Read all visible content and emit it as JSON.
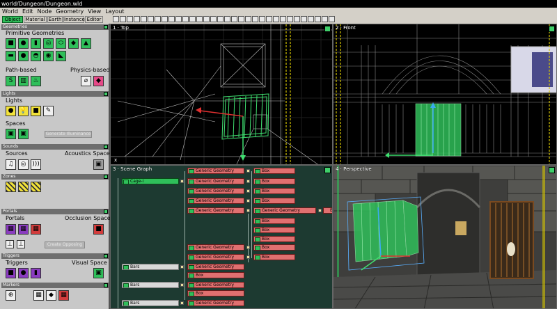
{
  "window": {
    "title": "world/Dungeon/Dungeon.wld"
  },
  "menu": [
    "World",
    "Edit",
    "Node",
    "Geometry",
    "View",
    "Layout"
  ],
  "tabs": [
    "Object",
    "Material",
    "Earth",
    "Instance",
    "Editor"
  ],
  "left": {
    "geometries": {
      "header": "Geometries",
      "primitive": "Primitive Geometries",
      "path": "Path-based",
      "physics": "Physics-based"
    },
    "lights": {
      "header": "Lights",
      "label": "Lights",
      "spaces": "Spaces",
      "generate": "Generate Illuminance"
    },
    "sounds": {
      "header": "Sounds",
      "sources": "Sources",
      "acoustics": "Acoustics Space"
    },
    "zones": {
      "header": "Zones"
    },
    "portals": {
      "header": "Portals",
      "label": "Portals",
      "occlusion": "Occlusion Space",
      "create": "Create Opposing"
    },
    "triggers": {
      "header": "Triggers",
      "label": "Triggers",
      "visual": "Visual Space"
    },
    "markers": {
      "header": "Markers"
    }
  },
  "viewports": {
    "top": "1 · Top",
    "front": "2 · Front",
    "scene": "3 · Scene Graph",
    "persp": "4 · Perspective",
    "axis": "x"
  },
  "scene": {
    "cage": "Cage-i",
    "bars": "Bars",
    "generic": "Generic Geometry",
    "box": "Box",
    "trunc": "B"
  },
  "colors": {
    "accent": "#2fbf5a",
    "node": "#e07070"
  }
}
